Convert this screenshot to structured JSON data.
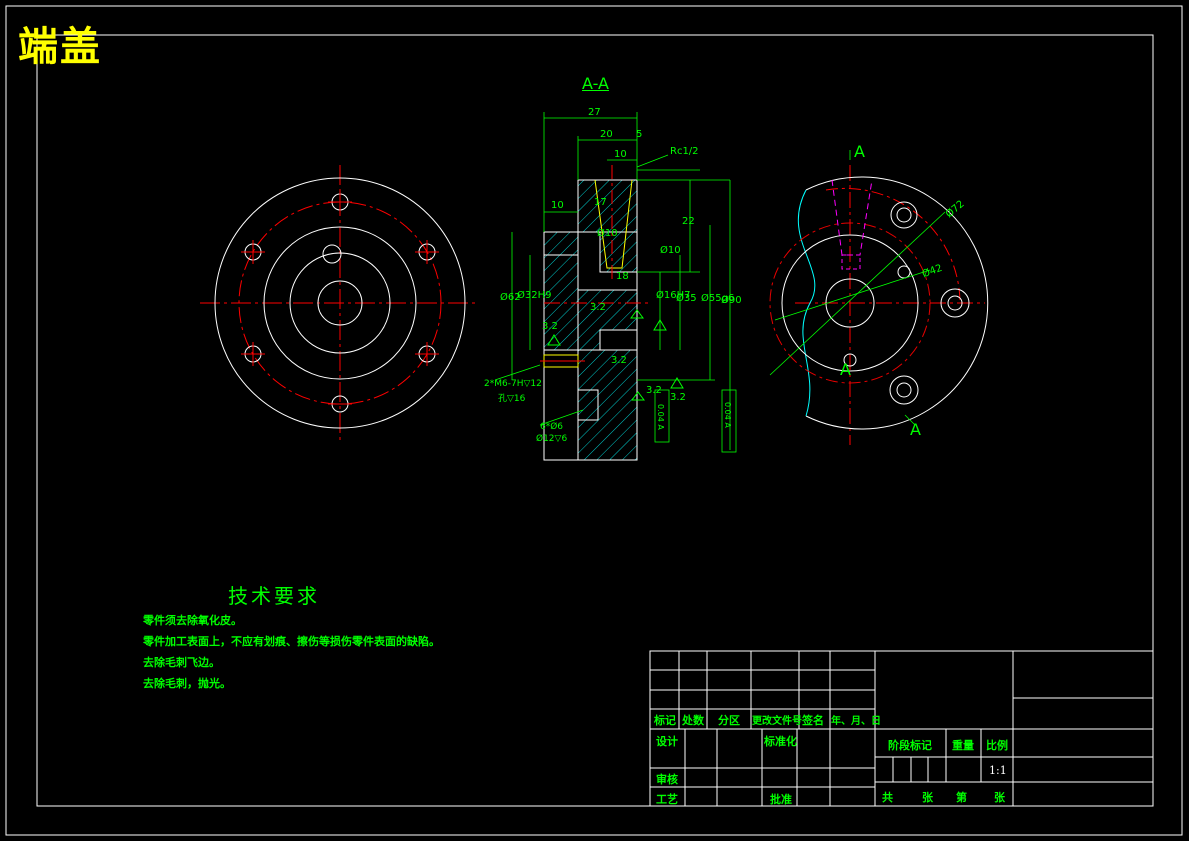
{
  "title": "端盖",
  "colors": {
    "background": "#000000",
    "frame": "#ffffff",
    "dimension": "#00ff00",
    "center": "#ff0000",
    "hidden": "#ff00ff",
    "title": "#ffff00",
    "spline": "#00ffff"
  },
  "section": {
    "label": "A-A",
    "dims": {
      "d27": "27",
      "d20": "20",
      "d5": "5",
      "d10top": "10",
      "rc": "Rc1/2",
      "d10left": "10",
      "d17": "17",
      "d22": "22",
      "phi10a": "Ø10",
      "phi10b": "Ø10",
      "d18": "18",
      "phi62": "Ø62",
      "phi32": "Ø32H9",
      "phi16": "Ø16H7",
      "phi35": "Ø35",
      "phi55": "Ø55g6",
      "phi90": "Ø90",
      "r32a": "3.2",
      "r32b": "3.2",
      "r32c": "3.2",
      "r32d": "3.2",
      "r32e": "3.2",
      "m6": "2*M6-7H▽12",
      "m6b": "孔▽16",
      "holes": "6*Ø6",
      "holesb": "Ø12▽6",
      "tol1": "0.04 A",
      "tol2": "0.04 A"
    }
  },
  "right_view": {
    "label_top": "A",
    "label_mid": "A",
    "label_bottom": "A",
    "phi72": "Ø72",
    "phi42": "Ø42"
  },
  "tech": {
    "heading": "技术要求",
    "lines": [
      "零件须去除氧化皮。",
      "零件加工表面上，不应有划痕、擦伤等损伤零件表面的缺陷。",
      "去除毛刺飞边。",
      "去除毛刺，抛光。"
    ]
  },
  "titleblock": {
    "biaoji": "标记",
    "chushu": "处数",
    "fenqu": "分区",
    "gengai": "更改文件号",
    "qianming": "签名",
    "riqi": "年、月、日",
    "sheji": "设计",
    "biaozhunhua": "标准化",
    "shenhe": "审核",
    "gongyi": "工艺",
    "pizhun": "批准",
    "jieduan": "阶段标记",
    "zhongliang": "重量",
    "bili": "比例",
    "scale": "1:1",
    "gong": "共",
    "zhang1": "张",
    "di": "第",
    "zhang2": "张"
  }
}
